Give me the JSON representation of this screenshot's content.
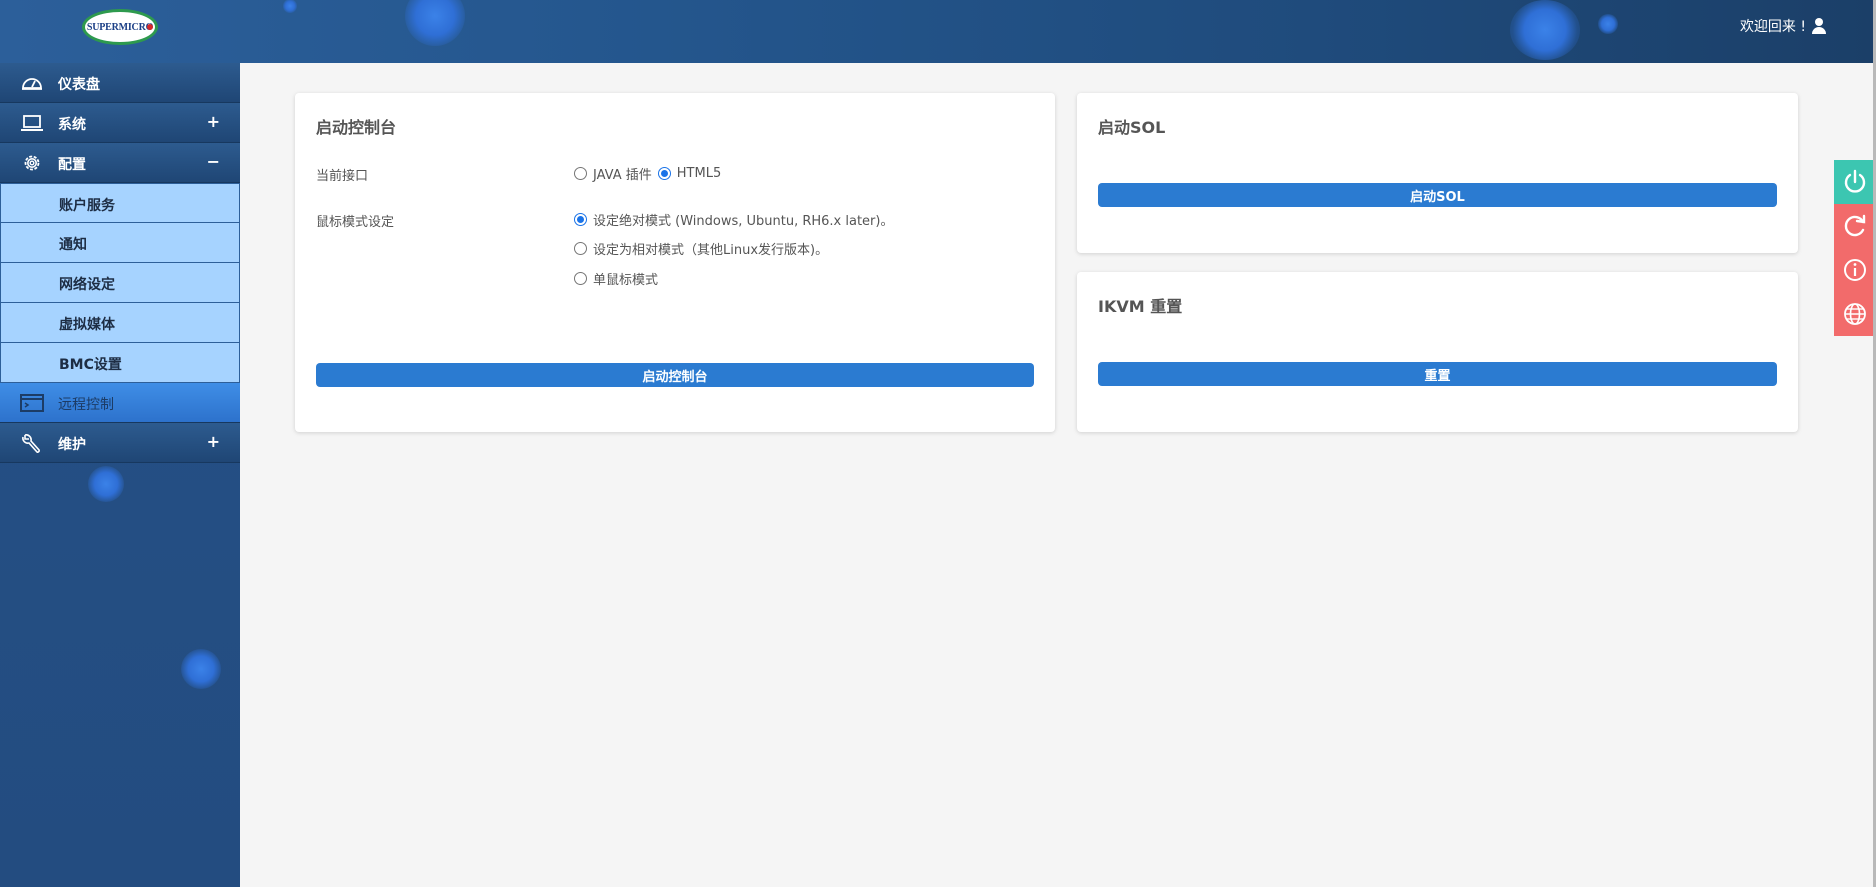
{
  "header": {
    "logo_text": "SUPERMICRO",
    "welcome": "欢迎回来 !"
  },
  "sidebar": {
    "items": [
      {
        "label": "仪表盘",
        "icon": "dashboard-icon"
      },
      {
        "label": "系统",
        "icon": "laptop-icon",
        "sign": "+"
      },
      {
        "label": "配置",
        "icon": "gear-icon",
        "sign": "−"
      },
      {
        "label": "远程控制",
        "icon": "console-icon",
        "active": true
      },
      {
        "label": "维护",
        "icon": "wrench-icon",
        "sign": "+"
      }
    ],
    "config_subitems": [
      "账户服务",
      "通知",
      "网络设定",
      "虚拟媒体",
      "BMC设置"
    ]
  },
  "launch_console": {
    "title": "启动控制台",
    "interface_label": "当前接口",
    "interface_options": [
      "JAVA 插件",
      "HTML5"
    ],
    "interface_selected": "HTML5",
    "mouse_label": "鼠标模式设定",
    "mouse_options": [
      "设定绝对模式 (Windows, Ubuntu, RH6.x later)。",
      "设定为相对模式（其他Linux发行版本)。",
      "单鼠标模式"
    ],
    "mouse_selected_index": 0,
    "button": "启动控制台"
  },
  "launch_sol": {
    "title": "启动SOL",
    "button": "启动SOL"
  },
  "ikvm_reset": {
    "title": "IKVM 重置",
    "button": "重置"
  },
  "actions": [
    "power-icon",
    "refresh-icon",
    "info-icon",
    "globe-icon"
  ],
  "colors": {
    "header": "#24568d",
    "sidebar": "#244f84",
    "submenu": "#a6d3ff",
    "button": "#2b7bd1",
    "power": "#3cc6b1",
    "alert": "#f26b6b"
  }
}
